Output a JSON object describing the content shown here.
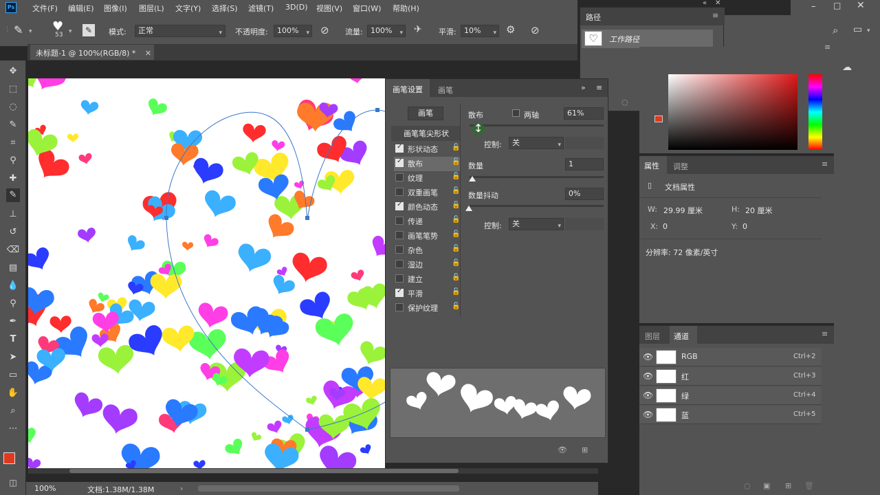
{
  "menubar": {
    "logo": "Ps",
    "items": [
      "文件(F)",
      "编辑(E)",
      "图像(I)",
      "图层(L)",
      "文字(Y)",
      "选择(S)",
      "滤镜(T)",
      "3D(D)",
      "视图(V)",
      "窗口(W)",
      "帮助(H)"
    ]
  },
  "options": {
    "brush_size": "53",
    "mode_label": "模式:",
    "mode_value": "正常",
    "opacity_label": "不透明度:",
    "opacity_value": "100%",
    "flow_label": "流量:",
    "flow_value": "100%",
    "smooth_label": "平滑:",
    "smooth_value": "10%"
  },
  "document": {
    "tab_title": "未标题-1 @ 100%(RGB/8) *",
    "zoom": "100%",
    "doc_size": "文档:1.38M/1.38M"
  },
  "paths_panel": {
    "title": "路径",
    "item": "工作路径"
  },
  "brush_panel": {
    "tabs": [
      "画笔设置",
      "画笔"
    ],
    "brush_button": "画笔",
    "tip_shape": "画笔笔尖形状",
    "items": [
      {
        "label": "形状动态",
        "checked": true
      },
      {
        "label": "散布",
        "checked": true
      },
      {
        "label": "纹理",
        "checked": false
      },
      {
        "label": "双重画笔",
        "checked": false
      },
      {
        "label": "颜色动态",
        "checked": true
      },
      {
        "label": "传递",
        "checked": false
      },
      {
        "label": "画笔笔势",
        "checked": false
      },
      {
        "label": "杂色",
        "checked": false
      },
      {
        "label": "湿边",
        "checked": false
      },
      {
        "label": "建立",
        "checked": false
      },
      {
        "label": "平滑",
        "checked": true
      },
      {
        "label": "保护纹理",
        "checked": false
      }
    ],
    "scatter_label": "散布",
    "both_axes_label": "两轴",
    "scatter_value": "61%",
    "control_label": "控制:",
    "control_value": "关",
    "count_label": "数量",
    "count_value": "1",
    "count_jitter_label": "数量抖动",
    "count_jitter_value": "0%",
    "control2_label": "控制:",
    "control2_value": "关"
  },
  "properties_panel": {
    "tabs": [
      "属性",
      "调整"
    ],
    "doc_props": "文档属性",
    "w_label": "W:",
    "w_value": "29.99 厘米",
    "h_label": "H:",
    "h_value": "20 厘米",
    "x_label": "X:",
    "x_value": "0",
    "y_label": "Y:",
    "y_value": "0",
    "resolution": "分辨率: 72 像素/英寸"
  },
  "channels_panel": {
    "tabs": [
      "图层",
      "通道"
    ],
    "rows": [
      {
        "name": "RGB",
        "shortcut": "Ctrl+2"
      },
      {
        "name": "红",
        "shortcut": "Ctrl+3"
      },
      {
        "name": "绿",
        "shortcut": "Ctrl+4"
      },
      {
        "name": "蓝",
        "shortcut": "Ctrl+5"
      }
    ]
  },
  "colors": {
    "foreground": "#e03a1e",
    "background": "#ffffff",
    "path_stroke": "#3a78c8",
    "hearts": [
      "#ff3ee6",
      "#ff2d2d",
      "#9bf23a",
      "#2a3cff",
      "#ffe92a",
      "#a43cff",
      "#3ab0ff",
      "#ff3a7a",
      "#5aff5a",
      "#ff7a2a",
      "#2a7aff",
      "#c23cff"
    ]
  }
}
